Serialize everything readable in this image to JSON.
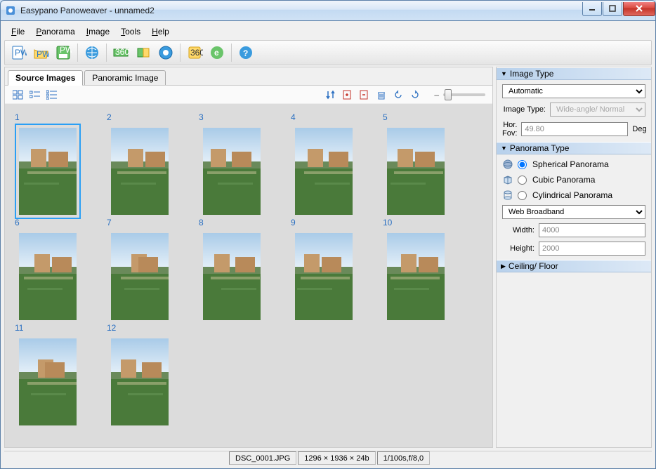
{
  "window": {
    "title": "Easypano Panoweaver - unnamed2"
  },
  "menu": [
    "File",
    "Panorama",
    "Image",
    "Tools",
    "Help"
  ],
  "toolbar_icons": [
    "new-doc-icon",
    "open-doc-icon",
    "save-doc-icon",
    "globe-icon",
    "wide-icon",
    "rect-icon",
    "circle-icon",
    "stitch-icon",
    "publish-icon",
    "help-icon"
  ],
  "tabs": {
    "source": "Source Images",
    "pano": "Panoramic Image",
    "active": "source"
  },
  "thumbs": {
    "count": 12,
    "selected": 1
  },
  "right": {
    "image_type": {
      "header": "Image Type",
      "mode": "Automatic",
      "type_label": "Image Type:",
      "type_value": "Wide-angle/ Normal",
      "fov_label": "Hor. Fov:",
      "fov_value": "49.80",
      "fov_unit": "Deg"
    },
    "panorama_type": {
      "header": "Panorama Type",
      "options": [
        "Spherical Panorama",
        "Cubic Panorama",
        "Cylindrical Panorama"
      ],
      "selected": "Spherical Panorama",
      "preset": "Web Broadband",
      "width_label": "Width:",
      "width_value": "4000",
      "height_label": "Height:",
      "height_value": "2000"
    },
    "ceiling": {
      "header": "Ceiling/ Floor"
    }
  },
  "status": {
    "filename": "DSC_0001.JPG",
    "dims": "1296 × 1936 × 24b",
    "exif": "1/100s,f/8,0"
  }
}
